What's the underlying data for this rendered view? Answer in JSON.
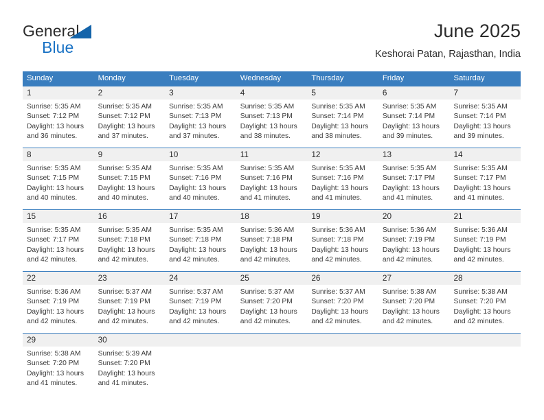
{
  "brand": {
    "name_part1": "General",
    "name_part2": "Blue",
    "triangle_color": "#1464aa",
    "blue_color": "#1871c4"
  },
  "header": {
    "title": "June 2025",
    "subtitle": "Keshorai Patan, Rajasthan, India"
  },
  "theme": {
    "header_blue": "#3a7ebf",
    "date_band_gray": "#f0f0f0",
    "text_dark": "#2b2b2b"
  },
  "weekdays": [
    "Sunday",
    "Monday",
    "Tuesday",
    "Wednesday",
    "Thursday",
    "Friday",
    "Saturday"
  ],
  "weeks": [
    {
      "days": [
        {
          "num": "1",
          "sunrise": "Sunrise: 5:35 AM",
          "sunset": "Sunset: 7:12 PM",
          "daylight1": "Daylight: 13 hours",
          "daylight2": "and 36 minutes."
        },
        {
          "num": "2",
          "sunrise": "Sunrise: 5:35 AM",
          "sunset": "Sunset: 7:12 PM",
          "daylight1": "Daylight: 13 hours",
          "daylight2": "and 37 minutes."
        },
        {
          "num": "3",
          "sunrise": "Sunrise: 5:35 AM",
          "sunset": "Sunset: 7:13 PM",
          "daylight1": "Daylight: 13 hours",
          "daylight2": "and 37 minutes."
        },
        {
          "num": "4",
          "sunrise": "Sunrise: 5:35 AM",
          "sunset": "Sunset: 7:13 PM",
          "daylight1": "Daylight: 13 hours",
          "daylight2": "and 38 minutes."
        },
        {
          "num": "5",
          "sunrise": "Sunrise: 5:35 AM",
          "sunset": "Sunset: 7:14 PM",
          "daylight1": "Daylight: 13 hours",
          "daylight2": "and 38 minutes."
        },
        {
          "num": "6",
          "sunrise": "Sunrise: 5:35 AM",
          "sunset": "Sunset: 7:14 PM",
          "daylight1": "Daylight: 13 hours",
          "daylight2": "and 39 minutes."
        },
        {
          "num": "7",
          "sunrise": "Sunrise: 5:35 AM",
          "sunset": "Sunset: 7:14 PM",
          "daylight1": "Daylight: 13 hours",
          "daylight2": "and 39 minutes."
        }
      ]
    },
    {
      "days": [
        {
          "num": "8",
          "sunrise": "Sunrise: 5:35 AM",
          "sunset": "Sunset: 7:15 PM",
          "daylight1": "Daylight: 13 hours",
          "daylight2": "and 40 minutes."
        },
        {
          "num": "9",
          "sunrise": "Sunrise: 5:35 AM",
          "sunset": "Sunset: 7:15 PM",
          "daylight1": "Daylight: 13 hours",
          "daylight2": "and 40 minutes."
        },
        {
          "num": "10",
          "sunrise": "Sunrise: 5:35 AM",
          "sunset": "Sunset: 7:16 PM",
          "daylight1": "Daylight: 13 hours",
          "daylight2": "and 40 minutes."
        },
        {
          "num": "11",
          "sunrise": "Sunrise: 5:35 AM",
          "sunset": "Sunset: 7:16 PM",
          "daylight1": "Daylight: 13 hours",
          "daylight2": "and 41 minutes."
        },
        {
          "num": "12",
          "sunrise": "Sunrise: 5:35 AM",
          "sunset": "Sunset: 7:16 PM",
          "daylight1": "Daylight: 13 hours",
          "daylight2": "and 41 minutes."
        },
        {
          "num": "13",
          "sunrise": "Sunrise: 5:35 AM",
          "sunset": "Sunset: 7:17 PM",
          "daylight1": "Daylight: 13 hours",
          "daylight2": "and 41 minutes."
        },
        {
          "num": "14",
          "sunrise": "Sunrise: 5:35 AM",
          "sunset": "Sunset: 7:17 PM",
          "daylight1": "Daylight: 13 hours",
          "daylight2": "and 41 minutes."
        }
      ]
    },
    {
      "days": [
        {
          "num": "15",
          "sunrise": "Sunrise: 5:35 AM",
          "sunset": "Sunset: 7:17 PM",
          "daylight1": "Daylight: 13 hours",
          "daylight2": "and 42 minutes."
        },
        {
          "num": "16",
          "sunrise": "Sunrise: 5:35 AM",
          "sunset": "Sunset: 7:18 PM",
          "daylight1": "Daylight: 13 hours",
          "daylight2": "and 42 minutes."
        },
        {
          "num": "17",
          "sunrise": "Sunrise: 5:35 AM",
          "sunset": "Sunset: 7:18 PM",
          "daylight1": "Daylight: 13 hours",
          "daylight2": "and 42 minutes."
        },
        {
          "num": "18",
          "sunrise": "Sunrise: 5:36 AM",
          "sunset": "Sunset: 7:18 PM",
          "daylight1": "Daylight: 13 hours",
          "daylight2": "and 42 minutes."
        },
        {
          "num": "19",
          "sunrise": "Sunrise: 5:36 AM",
          "sunset": "Sunset: 7:18 PM",
          "daylight1": "Daylight: 13 hours",
          "daylight2": "and 42 minutes."
        },
        {
          "num": "20",
          "sunrise": "Sunrise: 5:36 AM",
          "sunset": "Sunset: 7:19 PM",
          "daylight1": "Daylight: 13 hours",
          "daylight2": "and 42 minutes."
        },
        {
          "num": "21",
          "sunrise": "Sunrise: 5:36 AM",
          "sunset": "Sunset: 7:19 PM",
          "daylight1": "Daylight: 13 hours",
          "daylight2": "and 42 minutes."
        }
      ]
    },
    {
      "days": [
        {
          "num": "22",
          "sunrise": "Sunrise: 5:36 AM",
          "sunset": "Sunset: 7:19 PM",
          "daylight1": "Daylight: 13 hours",
          "daylight2": "and 42 minutes."
        },
        {
          "num": "23",
          "sunrise": "Sunrise: 5:37 AM",
          "sunset": "Sunset: 7:19 PM",
          "daylight1": "Daylight: 13 hours",
          "daylight2": "and 42 minutes."
        },
        {
          "num": "24",
          "sunrise": "Sunrise: 5:37 AM",
          "sunset": "Sunset: 7:19 PM",
          "daylight1": "Daylight: 13 hours",
          "daylight2": "and 42 minutes."
        },
        {
          "num": "25",
          "sunrise": "Sunrise: 5:37 AM",
          "sunset": "Sunset: 7:20 PM",
          "daylight1": "Daylight: 13 hours",
          "daylight2": "and 42 minutes."
        },
        {
          "num": "26",
          "sunrise": "Sunrise: 5:37 AM",
          "sunset": "Sunset: 7:20 PM",
          "daylight1": "Daylight: 13 hours",
          "daylight2": "and 42 minutes."
        },
        {
          "num": "27",
          "sunrise": "Sunrise: 5:38 AM",
          "sunset": "Sunset: 7:20 PM",
          "daylight1": "Daylight: 13 hours",
          "daylight2": "and 42 minutes."
        },
        {
          "num": "28",
          "sunrise": "Sunrise: 5:38 AM",
          "sunset": "Sunset: 7:20 PM",
          "daylight1": "Daylight: 13 hours",
          "daylight2": "and 42 minutes."
        }
      ]
    },
    {
      "days": [
        {
          "num": "29",
          "sunrise": "Sunrise: 5:38 AM",
          "sunset": "Sunset: 7:20 PM",
          "daylight1": "Daylight: 13 hours",
          "daylight2": "and 41 minutes."
        },
        {
          "num": "30",
          "sunrise": "Sunrise: 5:39 AM",
          "sunset": "Sunset: 7:20 PM",
          "daylight1": "Daylight: 13 hours",
          "daylight2": "and 41 minutes."
        },
        {
          "num": "",
          "sunrise": "",
          "sunset": "",
          "daylight1": "",
          "daylight2": ""
        },
        {
          "num": "",
          "sunrise": "",
          "sunset": "",
          "daylight1": "",
          "daylight2": ""
        },
        {
          "num": "",
          "sunrise": "",
          "sunset": "",
          "daylight1": "",
          "daylight2": ""
        },
        {
          "num": "",
          "sunrise": "",
          "sunset": "",
          "daylight1": "",
          "daylight2": ""
        },
        {
          "num": "",
          "sunrise": "",
          "sunset": "",
          "daylight1": "",
          "daylight2": ""
        }
      ]
    }
  ]
}
